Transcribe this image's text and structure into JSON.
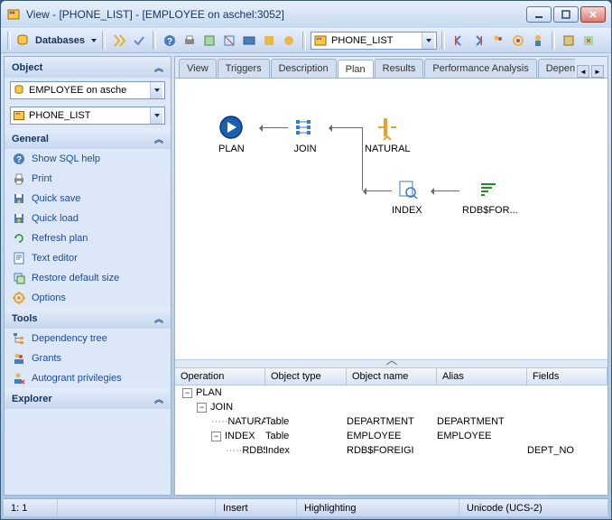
{
  "window": {
    "title": "View - [PHONE_LIST] - [EMPLOYEE on aschel:3052]"
  },
  "toolbar": {
    "databases_label": "Databases",
    "combo_value": "PHONE_LIST"
  },
  "sidebar": {
    "object": {
      "title": "Object",
      "combo1": "EMPLOYEE on asche",
      "combo2": "PHONE_LIST"
    },
    "general": {
      "title": "General",
      "items": [
        {
          "label": "Show SQL help",
          "icon": "help"
        },
        {
          "label": "Print",
          "icon": "print"
        },
        {
          "label": "Quick save",
          "icon": "save"
        },
        {
          "label": "Quick load",
          "icon": "load"
        },
        {
          "label": "Refresh plan",
          "icon": "refresh"
        },
        {
          "label": "Text editor",
          "icon": "text"
        },
        {
          "label": "Restore default size",
          "icon": "restore"
        },
        {
          "label": "Options",
          "icon": "options"
        }
      ]
    },
    "tools": {
      "title": "Tools",
      "items": [
        {
          "label": "Dependency tree",
          "icon": "tree"
        },
        {
          "label": "Grants",
          "icon": "grants"
        },
        {
          "label": "Autogrant privilegies",
          "icon": "autogrant"
        }
      ]
    },
    "explorer": {
      "title": "Explorer"
    }
  },
  "tabs": {
    "items": [
      "View",
      "Triggers",
      "Description",
      "Plan",
      "Results",
      "Performance Analysis",
      "Depende"
    ],
    "active": 3
  },
  "diagram": {
    "nodes": {
      "plan": "PLAN",
      "join": "JOIN",
      "natural": "NATURAL",
      "index": "INDEX",
      "rdbfor": "RDB$FOR..."
    }
  },
  "grid": {
    "columns": [
      "Operation",
      "Object type",
      "Object name",
      "Alias",
      "Fields"
    ],
    "rows": [
      {
        "indent": 0,
        "toggle": "-",
        "op": "PLAN",
        "type": "",
        "name": "",
        "alias": "",
        "fields": ""
      },
      {
        "indent": 1,
        "toggle": "-",
        "op": "JOIN",
        "type": "",
        "name": "",
        "alias": "",
        "fields": ""
      },
      {
        "indent": 2,
        "toggle": "",
        "op": "NATURAL",
        "type": "Table",
        "name": "DEPARTMENT",
        "alias": "DEPARTMENT",
        "fields": ""
      },
      {
        "indent": 2,
        "toggle": "-",
        "op": "INDEX",
        "type": "Table",
        "name": "EMPLOYEE",
        "alias": "EMPLOYEE",
        "fields": ""
      },
      {
        "indent": 3,
        "toggle": "",
        "op": "RDB$FO",
        "type": "Index",
        "name": "RDB$FOREIGI",
        "alias": "",
        "fields": "DEPT_NO"
      }
    ]
  },
  "status": {
    "pos": "1:   1",
    "mode": "Insert",
    "highlight": "Highlighting",
    "encoding": "Unicode (UCS-2)"
  }
}
